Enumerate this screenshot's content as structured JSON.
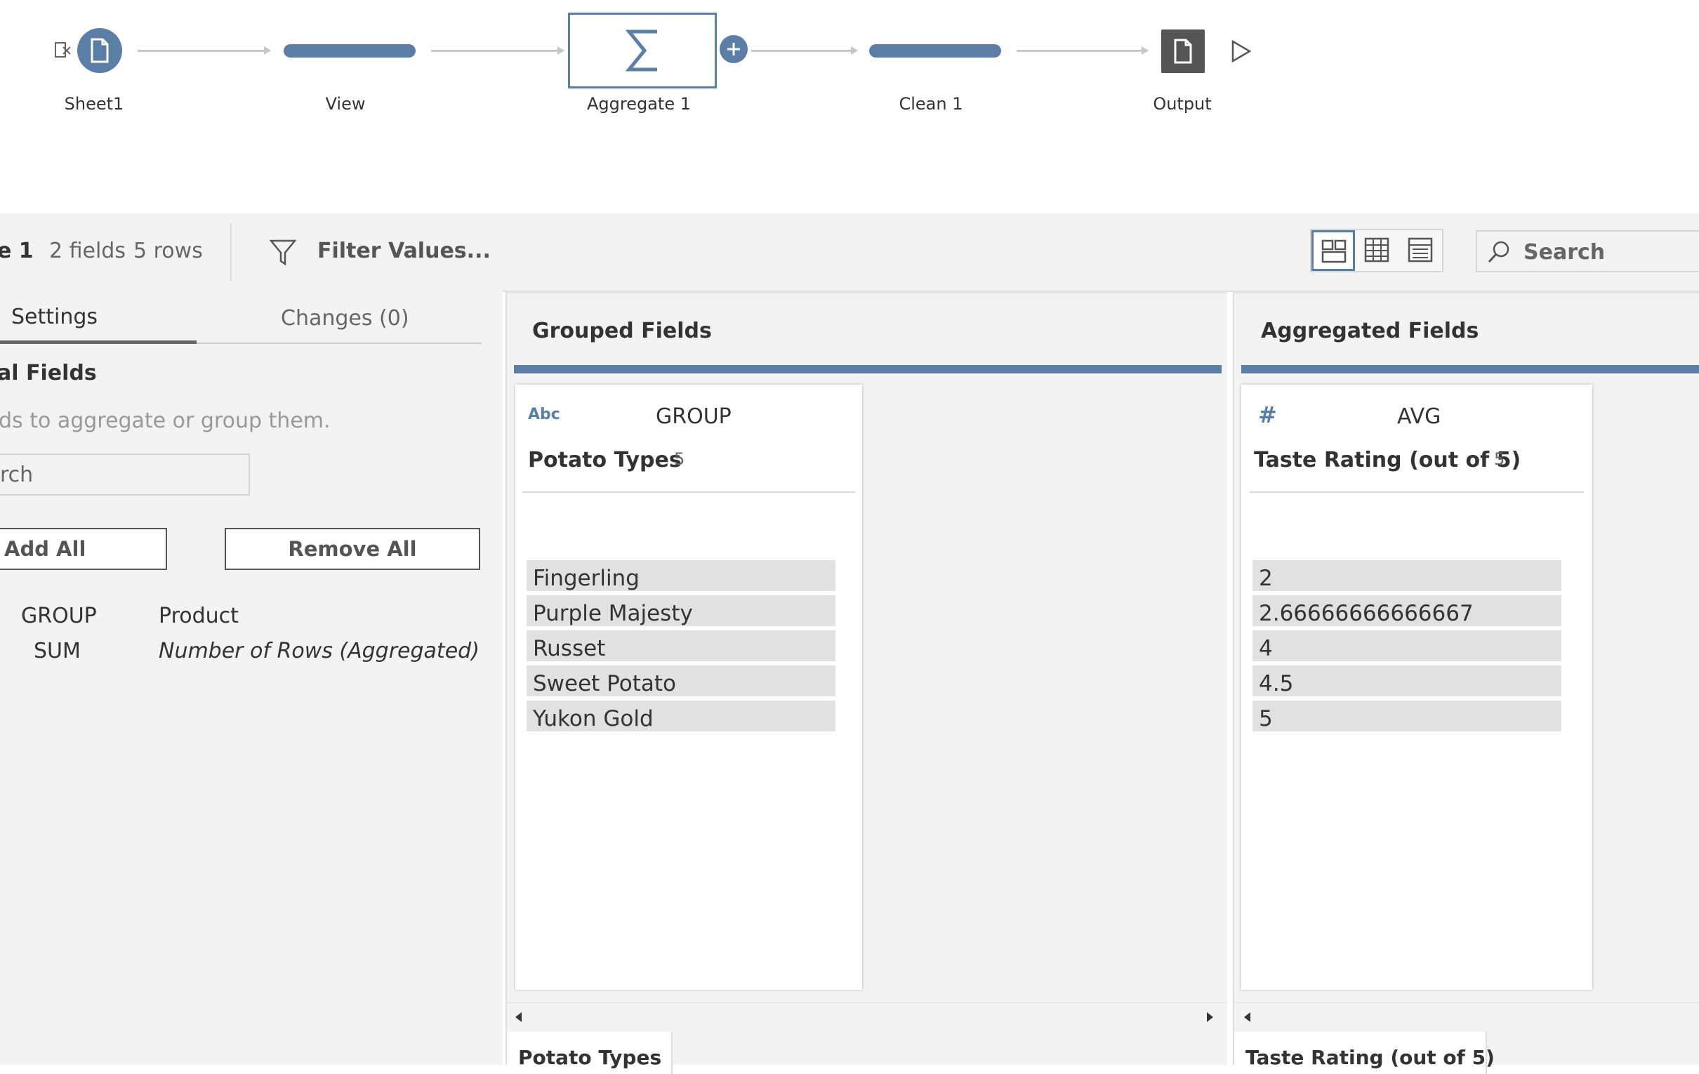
{
  "flow": {
    "nodes": [
      {
        "label": "Sheet1"
      },
      {
        "label": "View"
      },
      {
        "label": "Aggregate 1"
      },
      {
        "label": "Clean 1"
      },
      {
        "label": "Output"
      }
    ],
    "colors": {
      "accent": "#5b7ea6",
      "output": "#555555"
    }
  },
  "toolbar": {
    "step_name_fragment": "e 1",
    "fields_count": "2 fields",
    "rows_count": "5 rows",
    "filter_label": "Filter Values...",
    "search_placeholder": "Search"
  },
  "settings_panel": {
    "tabs": [
      {
        "label": "Settings",
        "active": true
      },
      {
        "label": "Changes (0)",
        "active": false
      }
    ],
    "section_title": "al Fields",
    "hint": "ds to aggregate or group them.",
    "search_placeholder": "rch",
    "add_all_label": "Add All",
    "remove_all_label": "Remove All",
    "fields": [
      {
        "aggregation": "GROUP",
        "name": "Product",
        "italic": false
      },
      {
        "aggregation": "SUM",
        "name": "Number of Rows (Aggregated)",
        "italic": true
      }
    ]
  },
  "grouped_pane": {
    "title": "Grouped Fields",
    "card": {
      "type_icon": "Abc",
      "aggregation": "GROUP",
      "field_name": "Potato Types",
      "count": "5",
      "values": [
        "Fingerling",
        "Purple Majesty",
        "Russet",
        "Sweet Potato",
        "Yukon Gold"
      ]
    },
    "bottom_tab": "Potato Types"
  },
  "aggregated_pane": {
    "title": "Aggregated Fields",
    "card": {
      "type_icon": "#",
      "aggregation": "AVG",
      "field_name": "Taste Rating (out of 5)",
      "count": "5",
      "values": [
        "2",
        "2.66666666666667",
        "4",
        "4.5",
        "5"
      ]
    },
    "bottom_tab": "Taste Rating (out of 5)"
  }
}
